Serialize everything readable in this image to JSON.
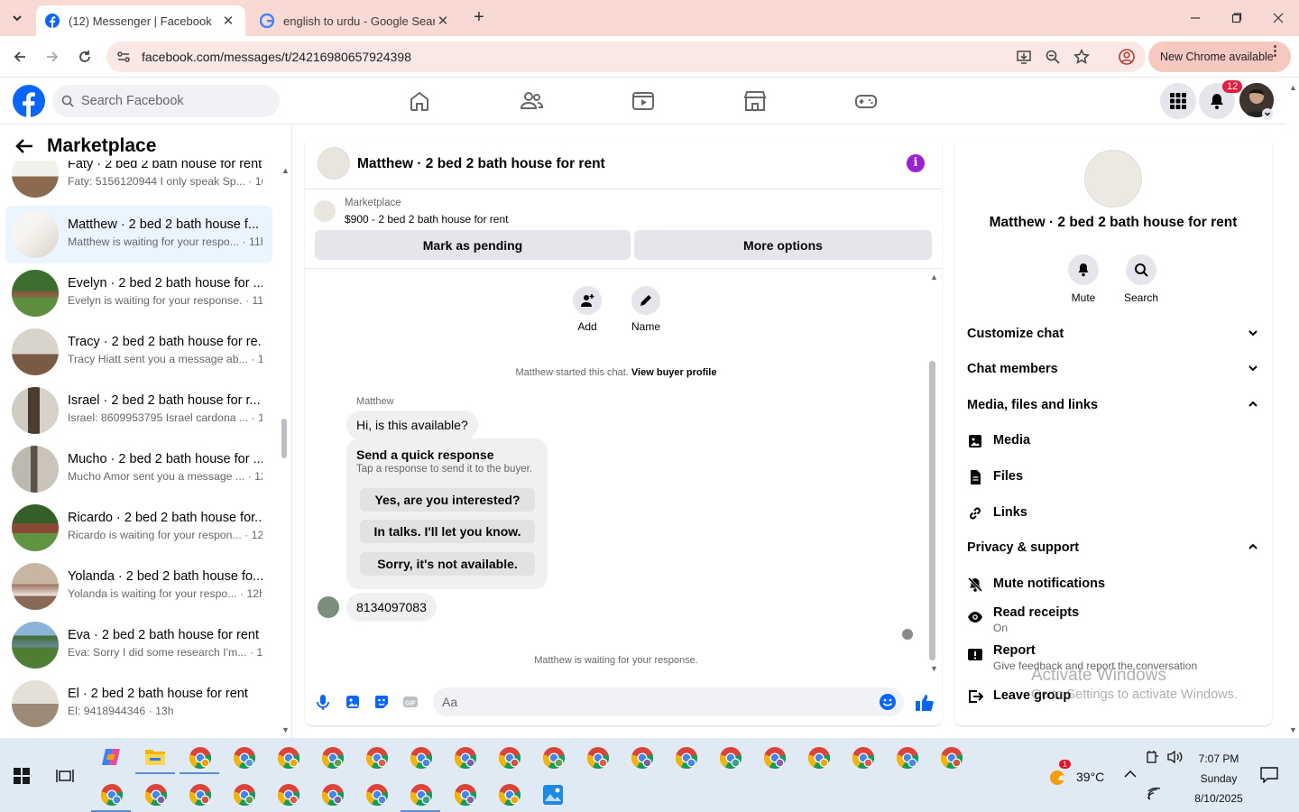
{
  "browser": {
    "tabs": [
      {
        "title": "(12) Messenger | Facebook",
        "active": true
      },
      {
        "title": "english to urdu - Google Search",
        "active": false
      }
    ],
    "url": "facebook.com/messages/t/24216980657924398",
    "update_label": "New Chrome available"
  },
  "fb": {
    "search_placeholder": "Search Facebook",
    "notif_count": "12"
  },
  "left": {
    "heading": "Marketplace",
    "conversations": [
      {
        "name": "Faty · 2 bed 2 bath house for rent",
        "preview": "Faty: 5156120944 I only speak Sp... · 10h",
        "active": false
      },
      {
        "name": "Matthew · 2 bed 2 bath house f...",
        "preview": "Matthew is waiting for your respo... · 11h",
        "active": true
      },
      {
        "name": "Evelyn · 2 bed 2 bath house for ...",
        "preview": "Evelyn is waiting for your response. · 11h",
        "active": false
      },
      {
        "name": "Tracy · 2 bed 2 bath house for re...",
        "preview": "Tracy Hiatt sent you a message ab... · 11h",
        "active": false
      },
      {
        "name": "Israel · 2 bed 2 bath house for r...",
        "preview": "Israel: 8609953795 Israel cardona ... · 12h",
        "active": false
      },
      {
        "name": "Mucho · 2 bed 2 bath house for ...",
        "preview": "Mucho Amor sent you a message ... · 12h",
        "active": false
      },
      {
        "name": "Ricardo · 2 bed 2 bath house for...",
        "preview": "Ricardo is waiting for your respon... · 12h",
        "active": false
      },
      {
        "name": "Yolanda · 2 bed 2 bath house fo...",
        "preview": "Yolanda is waiting for your respo... · 12h",
        "active": false
      },
      {
        "name": "Eva · 2 bed 2 bath house for rent",
        "preview": "Eva: Sorry I did some research I'm... · 13h",
        "active": false
      },
      {
        "name": "El · 2 bed 2 bath house for rent",
        "preview": "El: 9418944346 · 13h",
        "active": false
      }
    ]
  },
  "chat": {
    "title": "Matthew · 2 bed 2 bath house for rent",
    "marketplace_label": "Marketplace",
    "listing": "$900 - 2 bed 2 bath house for rent",
    "mark_pending": "Mark as pending",
    "more_options": "More options",
    "add_label": "Add",
    "name_label": "Name",
    "started_text": "Matthew started this chat.",
    "view_profile": "View buyer profile",
    "sender": "Matthew",
    "message1": "Hi, is this available?",
    "quick_title": "Send a quick response",
    "quick_sub": "Tap a response to send it to the buyer.",
    "quick_replies": [
      "Yes, are you interested?",
      "In talks. I'll let you know.",
      "Sorry, it's not available."
    ],
    "message2": "8134097083",
    "waiting": "Matthew is waiting for your response.",
    "input_placeholder": "Aa"
  },
  "info": {
    "title": "Matthew · 2 bed 2 bath house for rent",
    "mute": "Mute",
    "search": "Search",
    "sections": {
      "customize": "Customize chat",
      "members": "Chat members",
      "media_files": "Media, files and links",
      "media": "Media",
      "files": "Files",
      "links": "Links",
      "privacy": "Privacy & support",
      "mute_notif": "Mute notifications",
      "read_receipts": "Read receipts",
      "read_receipts_val": "On",
      "report": "Report",
      "report_sub": "Give feedback and report the conversation",
      "leave": "Leave group"
    }
  },
  "watermark": {
    "line1": "Activate Windows",
    "line2": "Go to Settings to activate Windows."
  },
  "taskbar": {
    "time": "7:07 PM",
    "day": "Sunday",
    "date": "8/10/2025",
    "temp": "39°C",
    "weather_badge": "1"
  }
}
